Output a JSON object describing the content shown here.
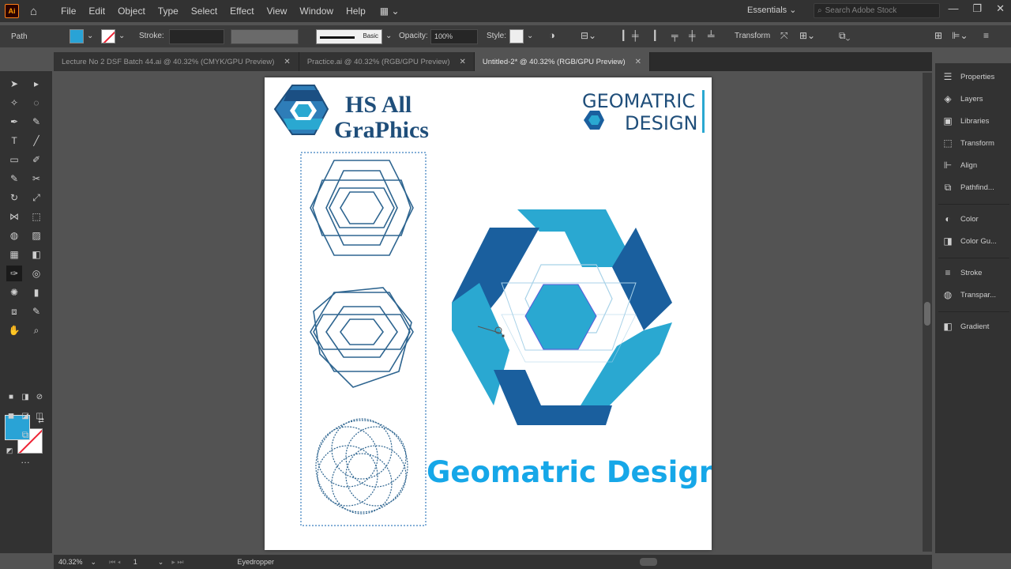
{
  "app": {
    "logo_text": "Ai"
  },
  "menu": [
    "File",
    "Edit",
    "Object",
    "Type",
    "Select",
    "Effect",
    "View",
    "Window",
    "Help"
  ],
  "workspace": "Essentials",
  "search_placeholder": "Search Adobe Stock",
  "control": {
    "selection_type": "Path",
    "stroke_label": "Stroke:",
    "brush": "Basic",
    "opacity_label": "Opacity:",
    "opacity_value": "100%",
    "style_label": "Style:",
    "transform_label": "Transform",
    "fill_color": "#29a3d6"
  },
  "tabs": [
    {
      "label": "Lecture No 2 DSF Batch 44.ai @ 40.32% (CMYK/GPU Preview)",
      "active": false
    },
    {
      "label": "Practice.ai @ 40.32% (RGB/GPU Preview)",
      "active": false
    },
    {
      "label": "Untitled-2* @ 40.32% (RGB/GPU Preview)",
      "active": true
    }
  ],
  "artwork": {
    "brand_line1": "HS All",
    "brand_line2": "GraPhics",
    "badge_line1": "GEOMATRIC",
    "badge_line2": "DESIGN",
    "caption": "Geomatric Design",
    "colors": {
      "dark_blue": "#1a5f9e",
      "light_blue": "#2aa8d1",
      "navy": "#1f4e7a",
      "caption": "#16a7e8",
      "outline": "#2e6590"
    }
  },
  "panels": [
    "Properties",
    "Layers",
    "Libraries",
    "Transform",
    "Align",
    "Pathfind...",
    "Color",
    "Color Gu...",
    "Stroke",
    "Transpar...",
    "Gradient"
  ],
  "status": {
    "zoom": "40.32%",
    "artboard": "1",
    "tool": "Eyedropper"
  }
}
